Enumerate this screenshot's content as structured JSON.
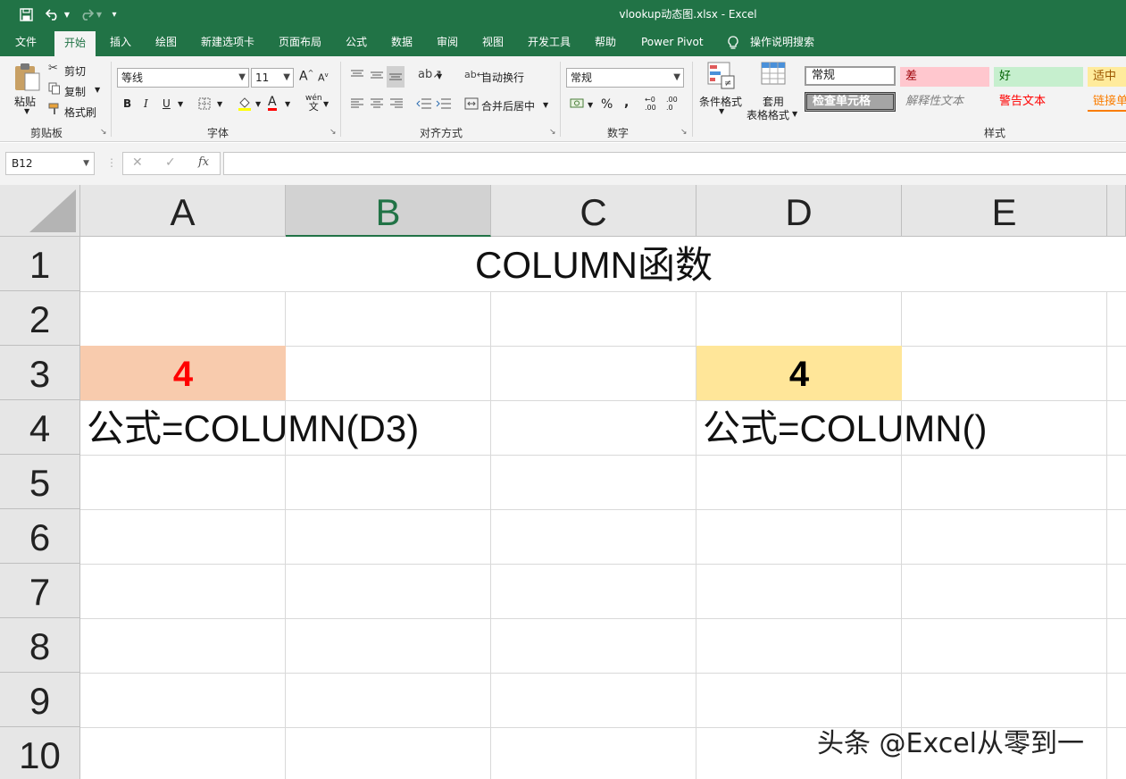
{
  "window": {
    "title": "vlookup动态图.xlsx  -  Excel"
  },
  "quick_access": {
    "save_icon": "save-icon",
    "undo_icon": "undo-icon",
    "redo_icon": "redo-icon",
    "customize_icon": "customize-quick-access-icon"
  },
  "tabs": [
    "文件",
    "开始",
    "插入",
    "绘图",
    "新建选项卡",
    "页面布局",
    "公式",
    "数据",
    "审阅",
    "视图",
    "开发工具",
    "帮助",
    "Power Pivot"
  ],
  "active_tab": "开始",
  "tell_me": "操作说明搜索",
  "ribbon": {
    "clipboard": {
      "paste": "粘贴",
      "cut": "剪切",
      "copy": "复制",
      "format_painter": "格式刷",
      "label": "剪贴板"
    },
    "font": {
      "font_name": "等线",
      "font_size": "11",
      "bold": "B",
      "italic": "I",
      "underline": "U",
      "grow": "A",
      "shrink": "A",
      "font_color_glyph": "A",
      "phonetic": "wén",
      "phonetic_sub": "文",
      "label": "字体"
    },
    "alignment": {
      "wrap_text": "自动换行",
      "merge_center": "合并后居中",
      "label": "对齐方式"
    },
    "number": {
      "format": "常规",
      "percent": "%",
      "comma": ",",
      "increase_decimal": ".00",
      "decrease_decimal": ".0",
      "label": "数字"
    },
    "styles": {
      "conditional_formatting": "条件格式",
      "format_as_table_line1": "套用",
      "format_as_table_line2": "表格格式",
      "gallery": [
        {
          "name": "常规",
          "bg": "#ffffff",
          "color": "#000000"
        },
        {
          "name": "差",
          "bg": "#ffc7ce",
          "color": "#9c0006"
        },
        {
          "name": "好",
          "bg": "#c6efce",
          "color": "#006100"
        },
        {
          "name": "适中",
          "bg": "#ffeb9c",
          "color": "#9c5700"
        },
        {
          "name": "检查单元格",
          "bg": "#a5a5a5",
          "color": "#ffffff"
        },
        {
          "name": "解释性文本",
          "bg": "#f3f3f3",
          "color": "#7f7f7f"
        },
        {
          "name": "警告文本",
          "bg": "#f3f3f3",
          "color": "#ff0000"
        },
        {
          "name": "链接单",
          "bg": "#f3f3f3",
          "color": "#fa7d00"
        }
      ],
      "label": "样式"
    }
  },
  "formula_bar": {
    "name_box": "B12",
    "cancel_glyph": "✕",
    "enter_glyph": "✓",
    "fx_glyph": "fx",
    "value": ""
  },
  "sheet": {
    "columns": [
      "A",
      "B",
      "C",
      "D",
      "E"
    ],
    "selected_column": "B",
    "rows": [
      "1",
      "2",
      "3",
      "4",
      "5",
      "6",
      "7",
      "8",
      "9",
      "10"
    ],
    "cells": {
      "title_merged": "COLUMN函数",
      "A3": "4",
      "D3": "4",
      "A4": "公式=COLUMN(D3)",
      "D4": "公式=COLUMN()"
    },
    "fills": {
      "A3": "#f8cbad",
      "D3": "#ffe699",
      "A3_text": "#ff0000"
    }
  },
  "watermark": "头条 @Excel从零到一",
  "colors": {
    "excel_green": "#217346",
    "ribbon_bg": "#f3f3f3",
    "header_bg": "#e6e6e6"
  }
}
